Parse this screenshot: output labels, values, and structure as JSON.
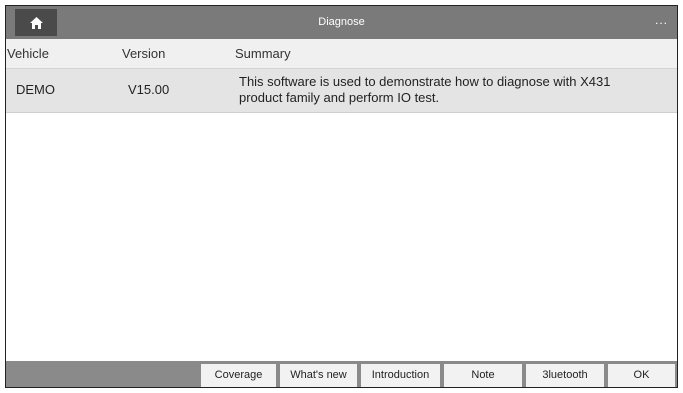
{
  "header": {
    "title": "Diagnose",
    "more_label": "..."
  },
  "table": {
    "columns": [
      "Vehicle",
      "Version",
      "Summary"
    ],
    "rows": [
      {
        "vehicle": "DEMO",
        "version": "V15.00",
        "summary": "This software is used to demonstrate how to diagnose with X431 product family and perform IO test."
      }
    ]
  },
  "footer": {
    "buttons": [
      "Coverage",
      "What's new",
      "Introduction",
      "Note",
      "3luetooth",
      "OK"
    ]
  }
}
